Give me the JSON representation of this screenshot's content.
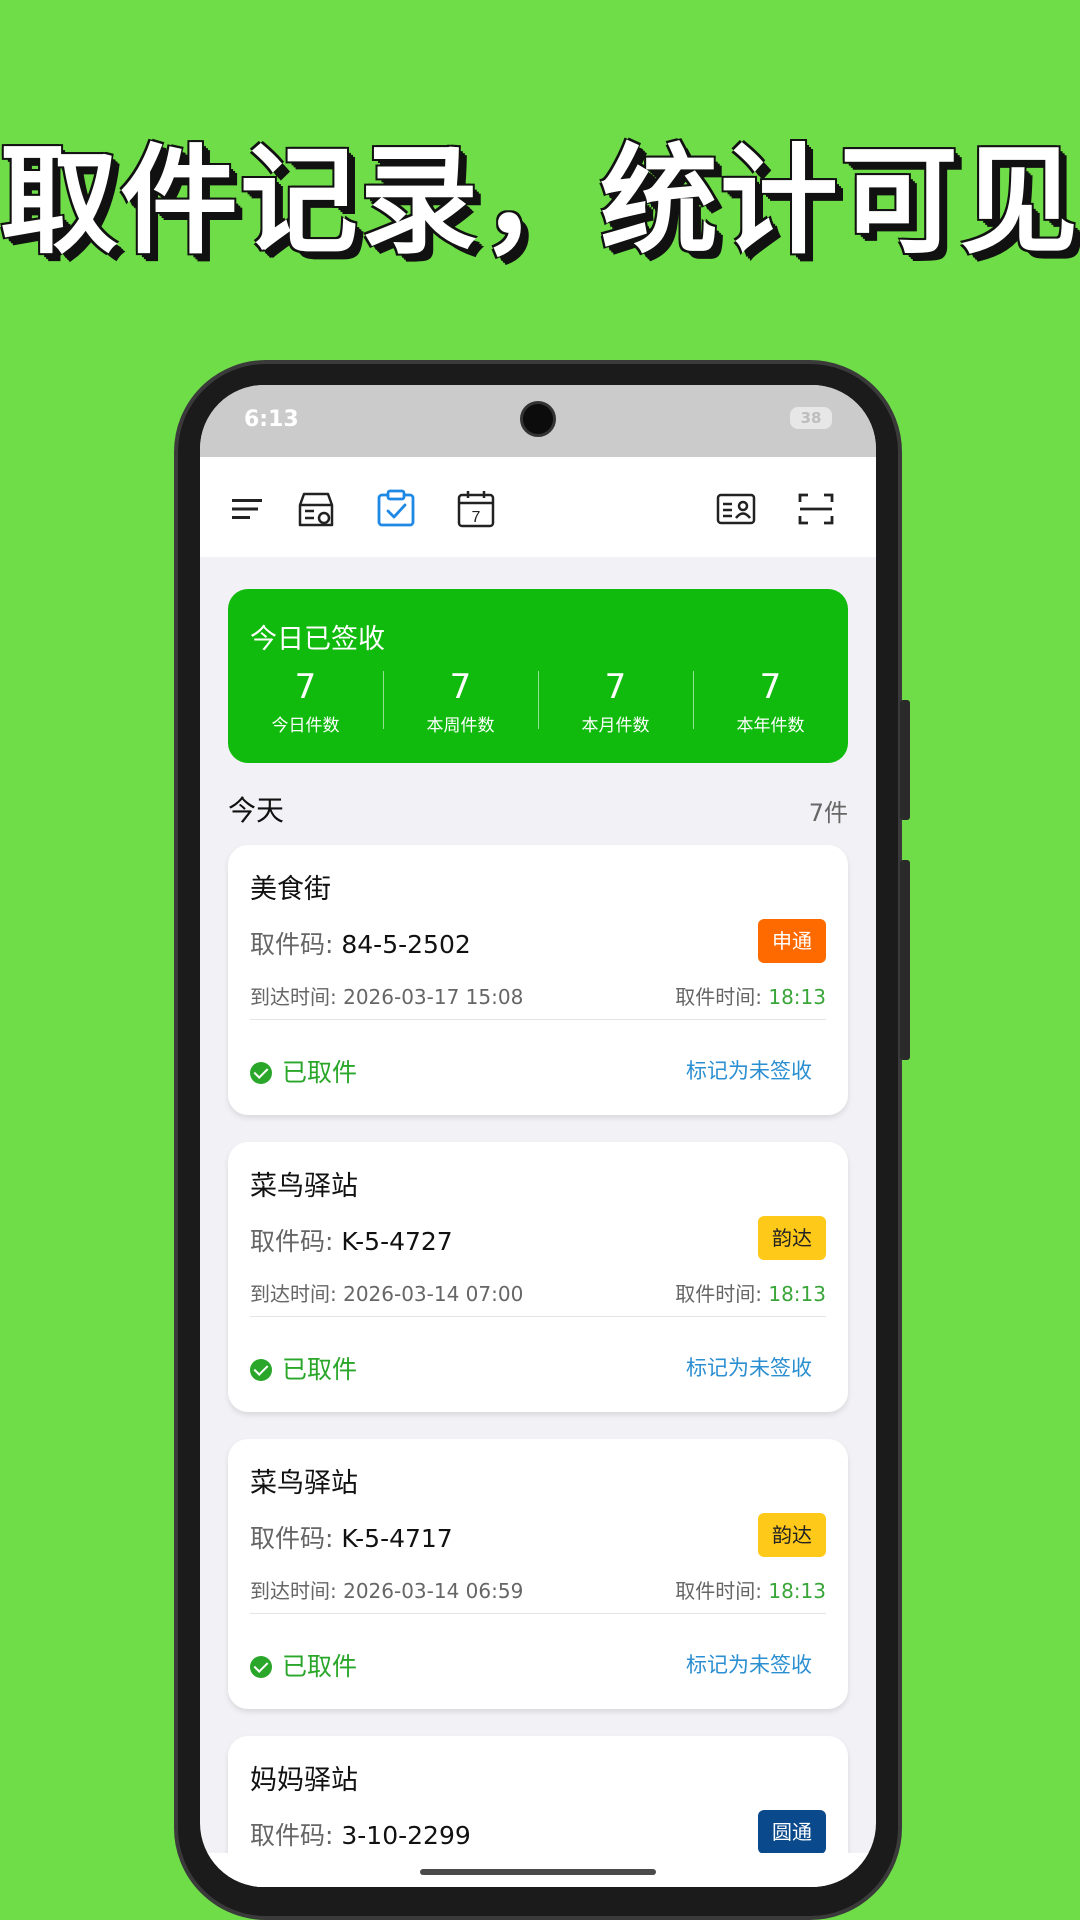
{
  "headline": "取件记录，统计可见",
  "status_bar": {
    "time": "6:13",
    "battery": "38"
  },
  "toolbar": {
    "icons": [
      "menu-icon",
      "parcel-locker-icon",
      "clipboard-check-icon",
      "calendar-icon",
      "id-card-icon",
      "scan-icon"
    ],
    "calendar_day": "7"
  },
  "stats": {
    "title": "今日已签收",
    "items": [
      {
        "value": "7",
        "label": "今日件数"
      },
      {
        "value": "7",
        "label": "本周件数"
      },
      {
        "value": "7",
        "label": "本月件数"
      },
      {
        "value": "7",
        "label": "本年件数"
      }
    ]
  },
  "section": {
    "title": "今天",
    "count": "7件"
  },
  "colors": {
    "accent_green": "#11bb0e",
    "link_blue": "#2b8fd1",
    "picked_green": "#2aa72a"
  },
  "cards": [
    {
      "station": "美食街",
      "code_label": "取件码: ",
      "code": "84-5-2502",
      "carrier": "申通",
      "carrier_bg": "#ff6a00",
      "carrier_fg": "#ffffff",
      "arrive": "到达时间: 2026-03-17 15:08",
      "pick_label": "取件时间: ",
      "pick_time": "18:13",
      "status": "已取件",
      "action": "标记为未签收"
    },
    {
      "station": "菜鸟驿站",
      "code_label": "取件码: ",
      "code": "K-5-4727",
      "carrier": "韵达",
      "carrier_bg": "#ffc91a",
      "carrier_fg": "#222222",
      "arrive": "到达时间: 2026-03-14 07:00",
      "pick_label": "取件时间: ",
      "pick_time": "18:13",
      "status": "已取件",
      "action": "标记为未签收"
    },
    {
      "station": "菜鸟驿站",
      "code_label": "取件码: ",
      "code": "K-5-4717",
      "carrier": "韵达",
      "carrier_bg": "#ffc91a",
      "carrier_fg": "#222222",
      "arrive": "到达时间: 2026-03-14 06:59",
      "pick_label": "取件时间: ",
      "pick_time": "18:13",
      "status": "已取件",
      "action": "标记为未签收"
    },
    {
      "station": "妈妈驿站",
      "code_label": "取件码: ",
      "code": "3-10-2299",
      "carrier": "圆通",
      "carrier_bg": "#0a4a8c",
      "carrier_fg": "#ffffff"
    }
  ]
}
